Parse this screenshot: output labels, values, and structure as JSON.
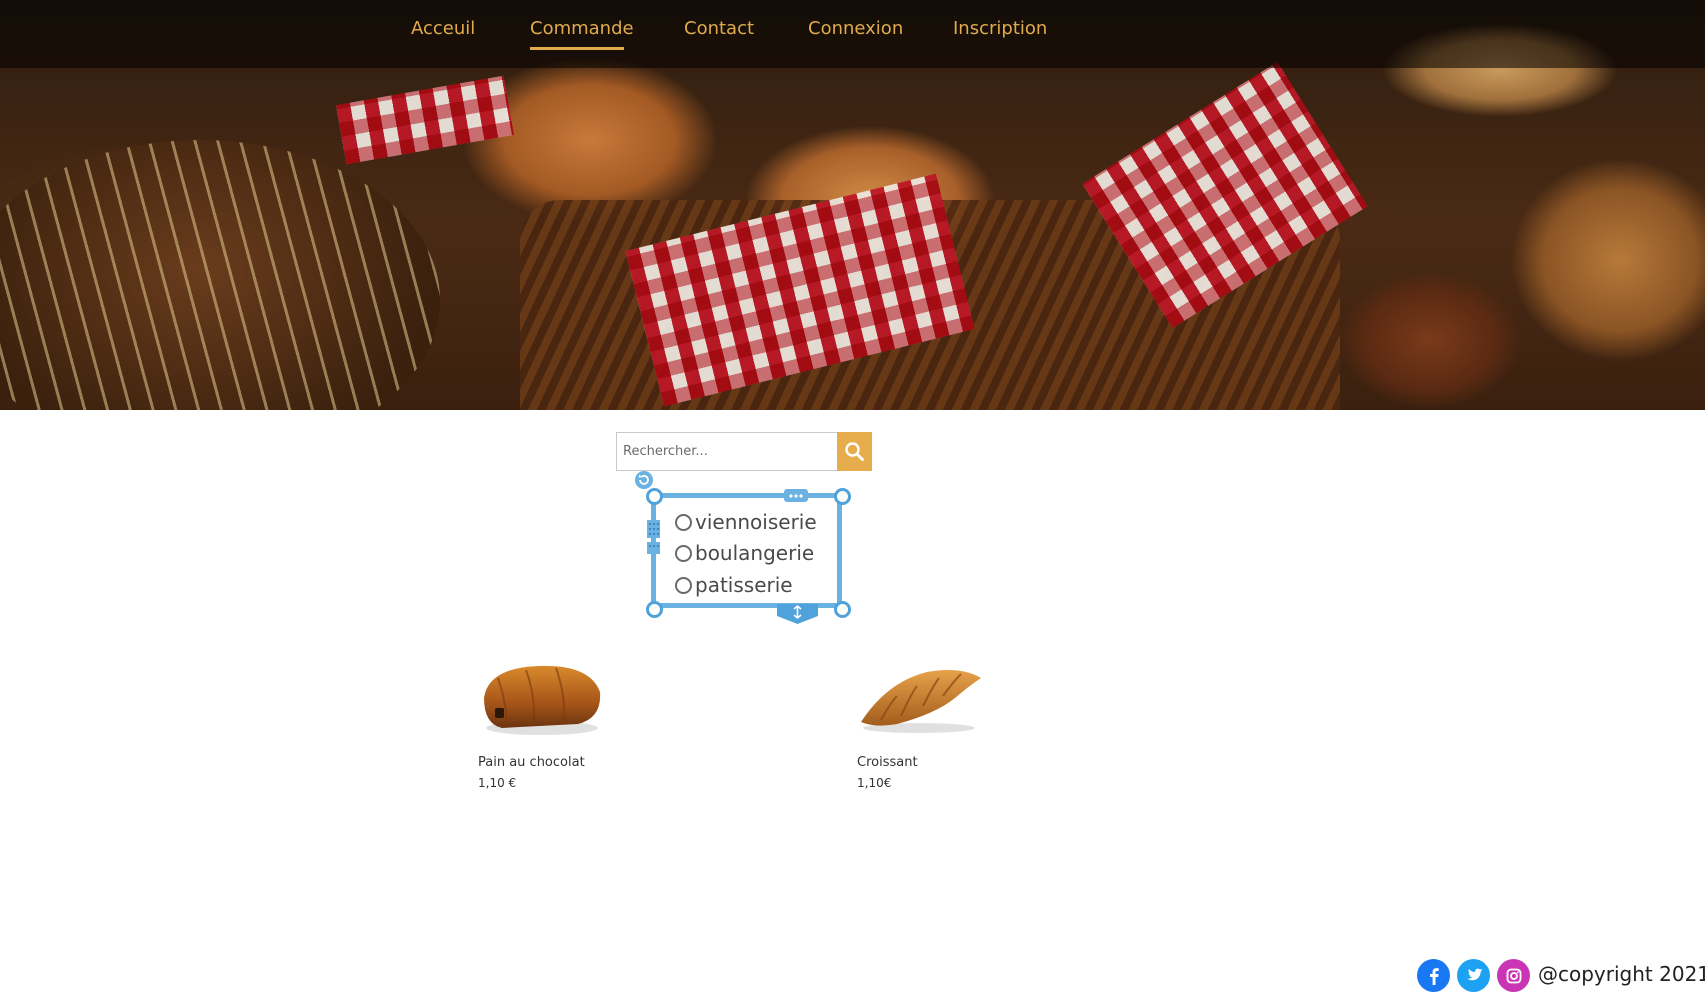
{
  "nav": {
    "items": [
      {
        "label": "Acceuil",
        "active": false
      },
      {
        "label": "Commande",
        "active": true
      },
      {
        "label": "Contact",
        "active": false
      },
      {
        "label": "Connexion",
        "active": false
      },
      {
        "label": "Inscription",
        "active": false
      }
    ]
  },
  "colors": {
    "accent": "#e0ab4a",
    "search_button": "#e7ac4c",
    "editor_frame": "#6ab2e2",
    "facebook": "#1877f2",
    "twitter": "#1da1f2",
    "instagram": "#c935b4"
  },
  "search": {
    "placeholder": "Rechercher...",
    "value": "",
    "icon": "search-icon"
  },
  "filters": {
    "options": [
      "viennoiserie",
      "boulangerie",
      "patisserie"
    ]
  },
  "products": [
    {
      "name": "Pain au chocolat",
      "price": "1,10 €"
    },
    {
      "name": "Croissant",
      "price": "1,10€"
    }
  ],
  "footer": {
    "social": [
      "facebook-icon",
      "twitter-icon",
      "instagram-icon"
    ],
    "copyright": "@copyright 2021"
  }
}
